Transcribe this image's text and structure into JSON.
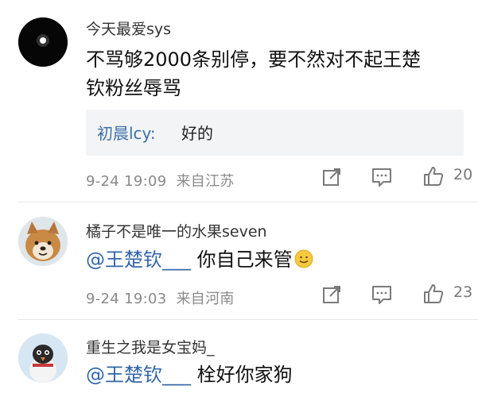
{
  "comments": [
    {
      "username": "今天最爱sys",
      "content_lines": [
        "不骂够2000条别停，要不然对不起王楚",
        "钦粉丝辱骂"
      ],
      "reply": {
        "name": "初晨lcy:",
        "text": "好的"
      },
      "date": "9-24 19:09",
      "location": "来自江苏",
      "likes": "20"
    },
    {
      "username": "橘子不是唯一的水果seven",
      "mention": "@王楚钦___",
      "text": " 你自己来管",
      "emoji": "smile-emoji",
      "date": "9-24 19:03",
      "location": "来自河南",
      "likes": "23"
    },
    {
      "username": "重生之我是女宝妈_",
      "mention": "@王楚钦___",
      "text": " 栓好你家狗"
    }
  ],
  "icons": {
    "share": "share-icon",
    "comment": "comment-icon",
    "like": "thumbs-up-icon"
  },
  "colors": {
    "mention": "#3366aa",
    "reply_name": "#3d6ea8",
    "meta": "#8a8a8a"
  }
}
